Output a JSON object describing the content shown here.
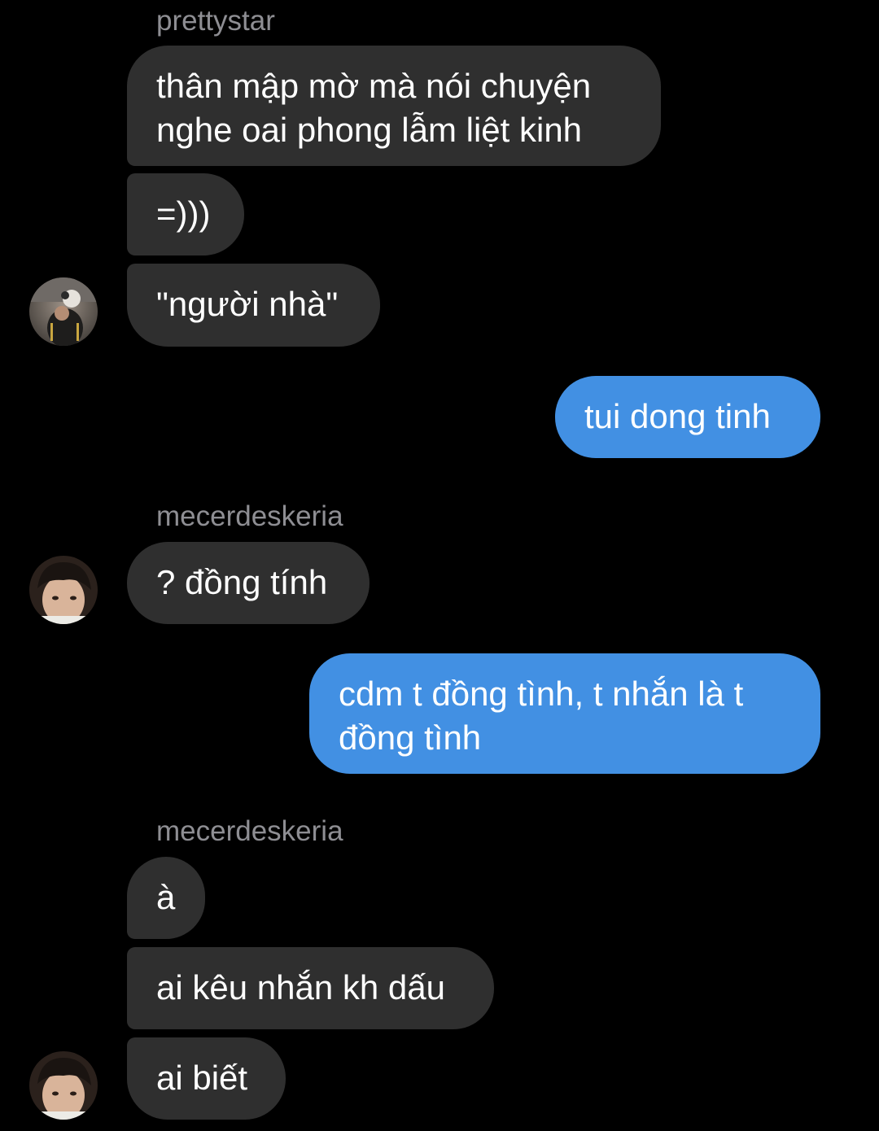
{
  "conversation": {
    "groups": [
      {
        "sender": "prettystar",
        "messages": [
          {
            "text": "thân mập mờ mà nói chuyện\nnghe oai phong lẫm liệt kinh"
          },
          {
            "text": "=)))"
          },
          {
            "text": "\"người nhà\""
          }
        ]
      },
      {
        "outgoing": true,
        "messages": [
          {
            "text": "tui dong tinh"
          }
        ]
      },
      {
        "sender": "mecerdeskeria",
        "messages": [
          {
            "text": "? đồng tính"
          }
        ]
      },
      {
        "outgoing": true,
        "messages": [
          {
            "text": "cdm t đồng tình, t nhắn là t\nđồng tình"
          }
        ]
      },
      {
        "sender": "mecerdeskeria",
        "messages": [
          {
            "text": "à"
          },
          {
            "text": "ai kêu nhắn kh dấu"
          },
          {
            "text": "ai biết"
          }
        ]
      }
    ]
  },
  "colors": {
    "background": "#000000",
    "incoming_bubble": "#2f2f2f",
    "outgoing_bubble": "#4290e3",
    "sender_label": "#8e8e93",
    "message_text": "#ffffff"
  },
  "icons": {
    "avatar_prettystar": "avatar-photo",
    "avatar_mecerdeskeria": "avatar-photo"
  }
}
